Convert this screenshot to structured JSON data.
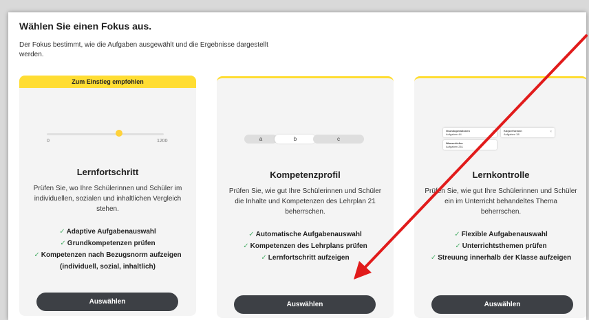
{
  "page": {
    "title": "Wählen Sie einen Fokus aus.",
    "description": "Der Fokus bestimmt, wie die Aufgaben ausgewählt und die Ergebnisse dargestellt werden."
  },
  "cards": [
    {
      "badge": "Zum Einstieg empfohlen",
      "slider": {
        "min_label": "0",
        "max_label": "1200",
        "value_fraction": 0.62
      },
      "title": "Lernfortschritt",
      "description": "Prüfen Sie, wo Ihre Schülerinnen und Schüler im individuellen, sozialen und inhaltlichen Vergleich stehen.",
      "features": [
        "Adaptive Aufgabenauswahl",
        "Grundkompetenzen prüfen",
        "Kompetenzen nach Bezugsnorm aufzeigen (individuell, sozial, inhaltlich)"
      ],
      "button": "Auswählen"
    },
    {
      "segments": [
        "a",
        "b",
        "c"
      ],
      "selected_segment": "b",
      "title": "Kompetenzprofil",
      "description": "Prüfen Sie, wie gut Ihre Schülerinnen und Schüler die Inhalte und Kompetenzen des Lehrplan 21 beherrschen.",
      "features": [
        "Automatische Aufgabenauswahl",
        "Kompetenzen des Lehrplans prüfen",
        "Lernfortschritt aufzeigen"
      ],
      "button": "Auswählen"
    },
    {
      "mini_cards": [
        {
          "title": "Grundoperationen",
          "sub": "Aufgaben 44"
        },
        {
          "title": "Körperformen",
          "sub": "Aufgaben 38"
        },
        {
          "title": "Wassertiefen",
          "sub": "Aufgaben 261"
        }
      ],
      "title": "Lernkontrolle",
      "description": "Prüfen Sie, wie gut Ihre Schülerinnen und Schüler ein im Unterricht behandeltes Thema beherrschen.",
      "features": [
        "Flexible Aufgabenauswahl",
        "Unterrichtsthemen prüfen",
        "Streuung innerhalb der Klasse aufzeigen"
      ],
      "button": "Auswählen"
    }
  ],
  "colors": {
    "accent_yellow": "#ffdd33",
    "button_dark": "#3d4045",
    "check_green": "#4caf6a",
    "annotation_arrow": "#e11b1b"
  }
}
